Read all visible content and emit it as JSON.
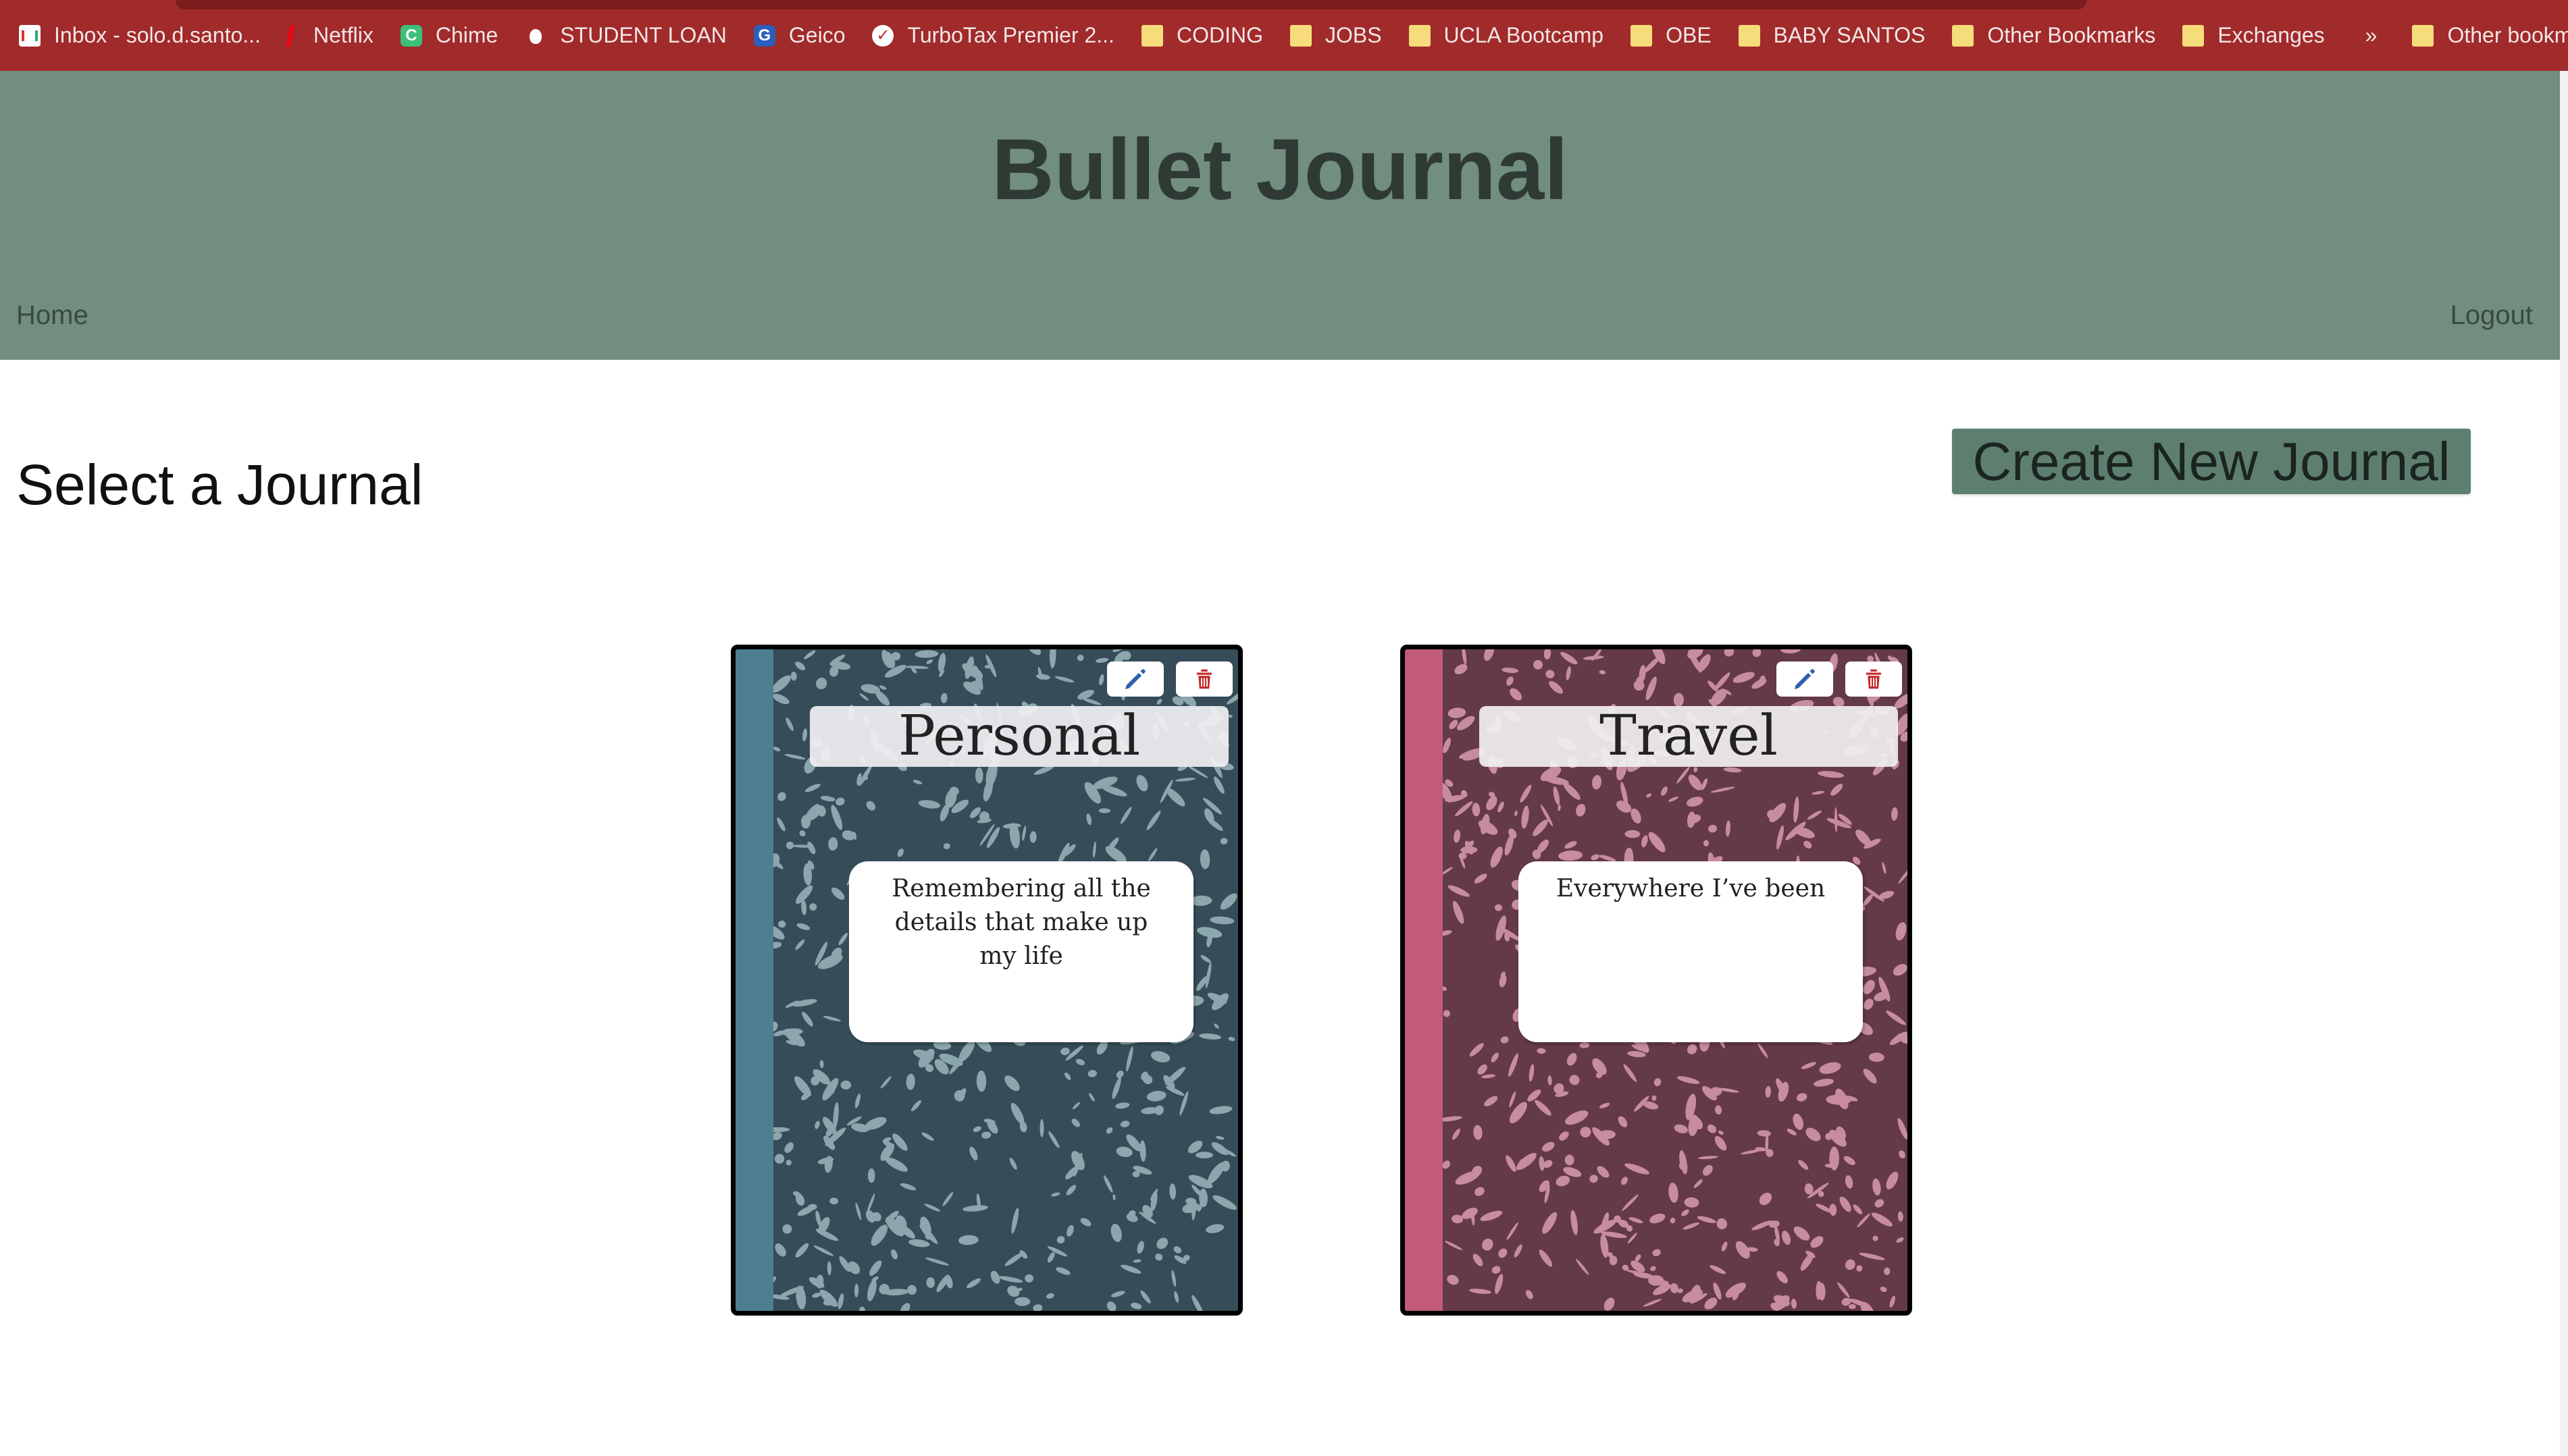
{
  "bookmarks": [
    {
      "label": "Inbox - solo.d.santo...",
      "icon": "gmail-icon"
    },
    {
      "label": "Netflix",
      "icon": "netflix-icon"
    },
    {
      "label": "Chime",
      "icon": "chime-icon"
    },
    {
      "label": "STUDENT LOAN",
      "icon": "student-loan-icon"
    },
    {
      "label": "Geico",
      "icon": "geico-icon"
    },
    {
      "label": "TurboTax Premier 2...",
      "icon": "turbotax-icon"
    },
    {
      "label": "CODING",
      "icon": "folder-icon"
    },
    {
      "label": "JOBS",
      "icon": "folder-icon"
    },
    {
      "label": "UCLA Bootcamp",
      "icon": "folder-icon"
    },
    {
      "label": "OBE",
      "icon": "folder-icon"
    },
    {
      "label": "BABY SANTOS",
      "icon": "folder-icon"
    },
    {
      "label": "Other Bookmarks",
      "icon": "folder-icon"
    },
    {
      "label": "Exchanges",
      "icon": "folder-icon"
    }
  ],
  "bookmarks_more": "»",
  "other_bookmarks": "Other bookmarks",
  "header": {
    "title": "Bullet Journal",
    "nav_home": "Home",
    "nav_logout": "Logout"
  },
  "main": {
    "heading": "Select a Journal",
    "create_button": "Create New Journal",
    "journals": [
      {
        "title": "Personal",
        "description": "Remembering all the details that make up my life",
        "cover_color": "#364c58",
        "spine_color": "#4e7f90"
      },
      {
        "title": "Travel",
        "description": "Everywhere I’ve been",
        "cover_color": "#643948",
        "spine_color": "#c25b7a"
      }
    ]
  },
  "colors": {
    "bookmarks_bar": "#a12a2a",
    "header_bg": "#718e7f",
    "button_bg": "#5e7f6f",
    "edit_icon": "#2f5fae",
    "delete_icon": "#c62828"
  }
}
